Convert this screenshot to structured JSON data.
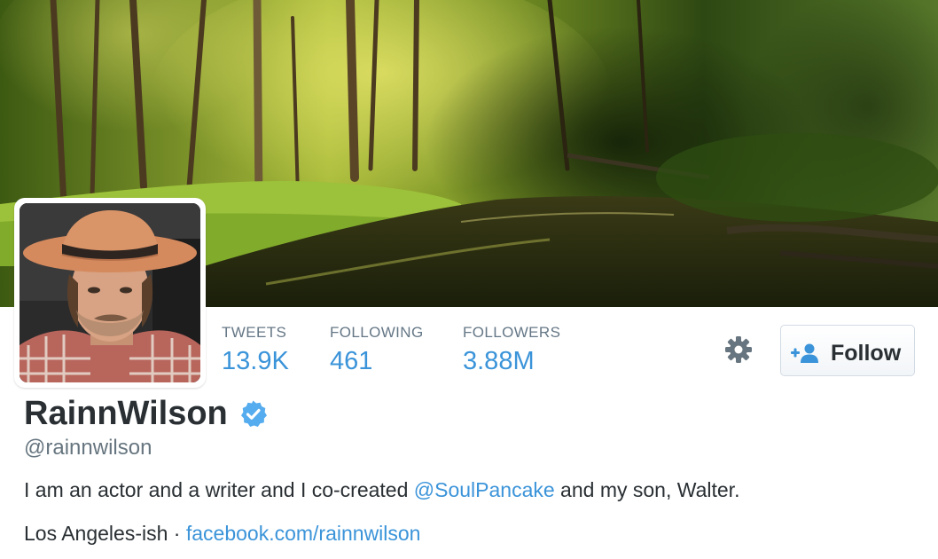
{
  "profile": {
    "full_name": "RainnWilson",
    "screen_name": "@rainnwilson",
    "bio": {
      "before": "I am an actor and a writer and I co-created ",
      "mention": "@SoulPancake",
      "after": " and my son, Walter."
    },
    "location": "Los Angeles-ish",
    "separator": " · ",
    "website": "facebook.com/rainnwilson"
  },
  "stats": {
    "tweets_label": "TWEETS",
    "tweets_value": "13.9K",
    "following_label": "FOLLOWING",
    "following_value": "461",
    "followers_label": "FOLLOWERS",
    "followers_value": "3.88M"
  },
  "actions": {
    "follow_label": "Follow",
    "settings_icon": "gear-icon",
    "follow_icon": "add-user-icon",
    "verified_icon": "verified-badge-icon"
  },
  "colors": {
    "link": "#3b94d9",
    "text": "#292f33",
    "muted": "#66757f",
    "verified": "#55acee"
  }
}
